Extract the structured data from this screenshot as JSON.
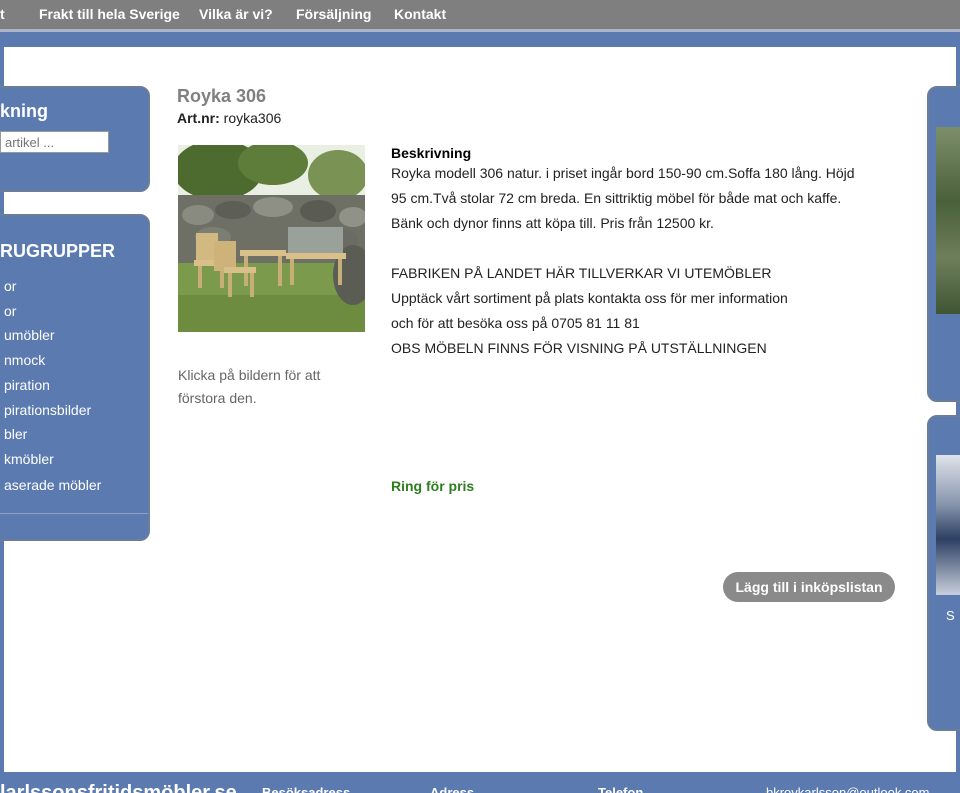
{
  "nav": {
    "items": [
      {
        "label": "t"
      },
      {
        "label": "Frakt till hela Sverige"
      },
      {
        "label": "Vilka är vi?"
      },
      {
        "label": "Försäljning"
      },
      {
        "label": "Kontakt"
      }
    ]
  },
  "sidebar": {
    "search_title": "kning",
    "search_placeholder": "artikel ...",
    "groups_title": "RUGRUPPER",
    "categories": [
      {
        "label": "or"
      },
      {
        "label": "or"
      },
      {
        "label": "umöbler"
      },
      {
        "label": "nmock"
      },
      {
        "label": "piration"
      },
      {
        "label": "pirationsbilder"
      },
      {
        "label": "bler"
      },
      {
        "label": "kmöbler"
      },
      {
        "label": "aserade möbler"
      }
    ]
  },
  "product": {
    "title": "Royka 306",
    "artnr_label": "Art.nr:",
    "artnr_value": "royka306",
    "image_caption": "Klicka på bildern för att förstora den.",
    "description_title": "Beskrivning",
    "description_lines": [
      "Royka modell 306 natur. i priset ingår bord 150-90 cm.Soffa 180 lång. Höjd",
      "95 cm.Två stolar 72 cm breda. En sittriktig möbel för både mat och kaffe.",
      "Bänk och dynor finns att köpa till. Pris från 12500 kr.",
      "",
      "FABRIKEN PÅ LANDET HÄR TILLVERKAR VI UTEMÖBLER",
      "Upptäck vårt sortiment på plats kontakta oss för mer information",
      "och för att besöka oss på 0705 81 11 81",
      "OBS MÖBELN FINNS FÖR VISNING PÅ UTSTÄLLNINGEN"
    ],
    "price_text": "Ring för pris",
    "add_button": "Lägg till i inköpslistan"
  },
  "right_sidebar": {
    "text": "S"
  },
  "footer": {
    "brand": "larlssonsfritidsmöbler.se",
    "visit": "Besöksadress",
    "address": "Adress",
    "phone": "Telefon",
    "email": "bkroykarlsson@outlook.com"
  }
}
